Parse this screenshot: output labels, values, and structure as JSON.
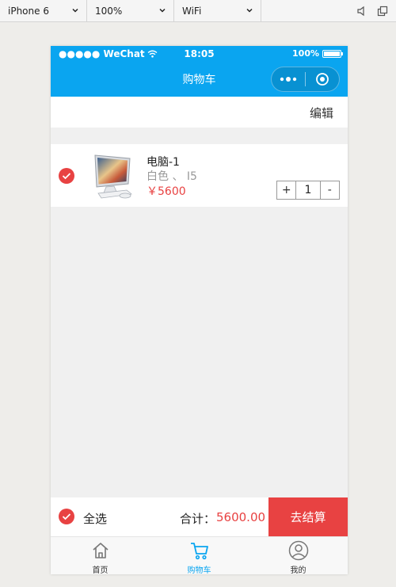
{
  "toolbar": {
    "device": "iPhone 6",
    "zoom": "100%",
    "network": "WiFi"
  },
  "status_bar": {
    "carrier": "●●●●● WeChat",
    "time": "18:05",
    "battery": "100%"
  },
  "nav": {
    "title": "购物车",
    "accent_color": "#0aa5f0"
  },
  "edit_label": "编辑",
  "cart_items": [
    {
      "name": "电脑-1",
      "spec": "白色 、 I5",
      "price": "￥5600",
      "increase_label": "+",
      "quantity": "1",
      "decrease_label": "-",
      "checked": true
    }
  ],
  "checkout": {
    "select_all_label": "全选",
    "total_label": "合计：",
    "total_value": "5600.00",
    "pay_label": "去结算",
    "price_color": "#e84242"
  },
  "tabbar": {
    "tabs": [
      {
        "label": "首页",
        "icon": "home-icon",
        "active": false
      },
      {
        "label": "购物车",
        "icon": "cart-icon",
        "active": true
      },
      {
        "label": "我的",
        "icon": "user-icon",
        "active": false
      }
    ]
  }
}
